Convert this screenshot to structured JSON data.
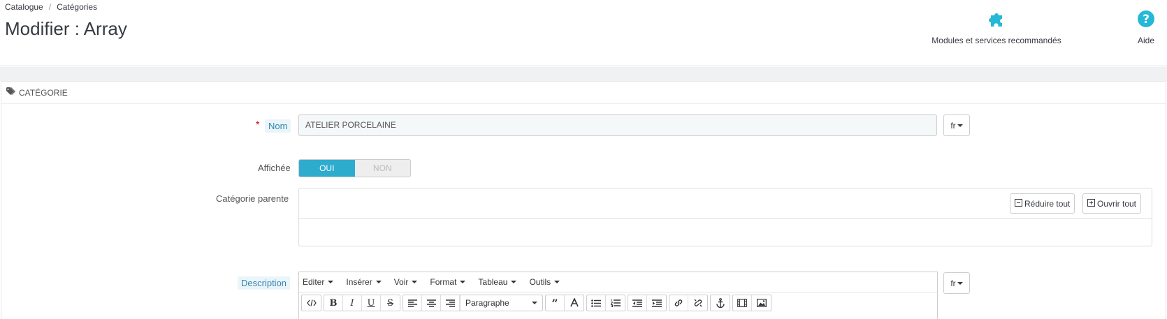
{
  "breadcrumb": {
    "items": [
      "Catalogue",
      "Catégories"
    ],
    "separator": "/"
  },
  "page_title": "Modifier : Array",
  "toolbar": {
    "modules_label": "Modules et services recommandés",
    "aide_label": "Aide",
    "icon_color": "#25b9d7"
  },
  "panel": {
    "heading": "CATÉGORIE"
  },
  "form": {
    "nom": {
      "label": "Nom",
      "required_mark": "*",
      "value": "ATELIER PORCELAINE",
      "lang": "fr"
    },
    "affichee": {
      "label": "Affichée",
      "on_label": "OUI",
      "off_label": "NON",
      "value": "OUI"
    },
    "categorie_parente": {
      "label": "Catégorie parente",
      "collapse_label": "Réduire tout",
      "expand_label": "Ouvrir tout"
    },
    "description": {
      "label": "Description",
      "lang": "fr",
      "menus": [
        "Editer",
        "Insérer",
        "Voir",
        "Format",
        "Tableau",
        "Outils"
      ],
      "format_select": "Paragraphe"
    }
  }
}
